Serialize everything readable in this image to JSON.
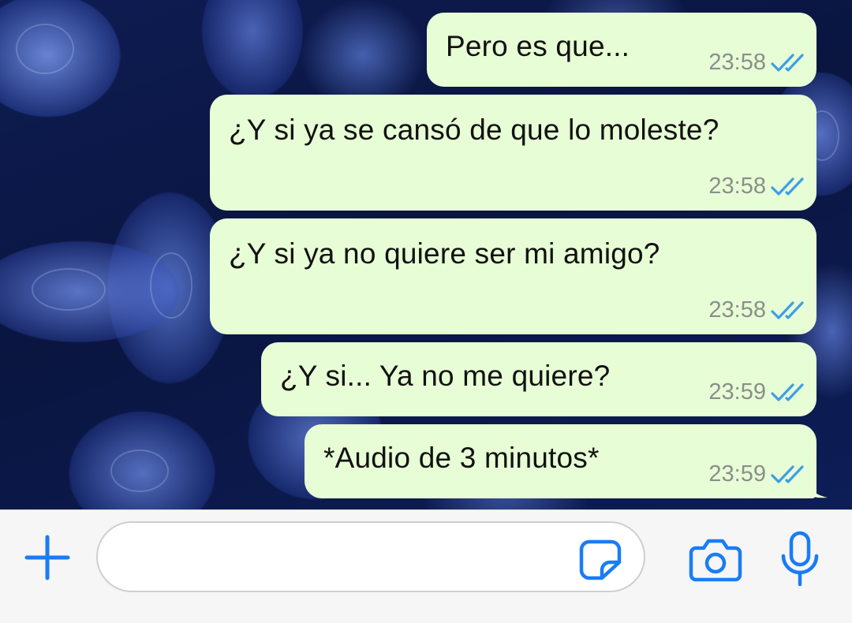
{
  "chat": {
    "messages": [
      {
        "text": "Pero es que...",
        "time": "23:58",
        "status": "read"
      },
      {
        "text": "¿Y si ya se cansó de que lo moleste?",
        "time": "23:58",
        "status": "read"
      },
      {
        "text": "¿Y si ya no quiere ser mi amigo?",
        "time": "23:58",
        "status": "read"
      },
      {
        "text": "¿Y si... Ya no me quiere?",
        "time": "23:59",
        "status": "read"
      },
      {
        "text": "*Audio de 3 minutos*",
        "time": "23:59",
        "status": "read"
      }
    ],
    "bubble_color": "#e7fdd5",
    "tick_color": "#3d9ee8"
  },
  "input_bar": {
    "message_input": {
      "value": "",
      "placeholder": ""
    },
    "icons": {
      "attach": "plus-icon",
      "sticker": "sticker-icon",
      "camera": "camera-icon",
      "mic": "microphone-icon"
    },
    "accent_color": "#1a7cf5"
  }
}
